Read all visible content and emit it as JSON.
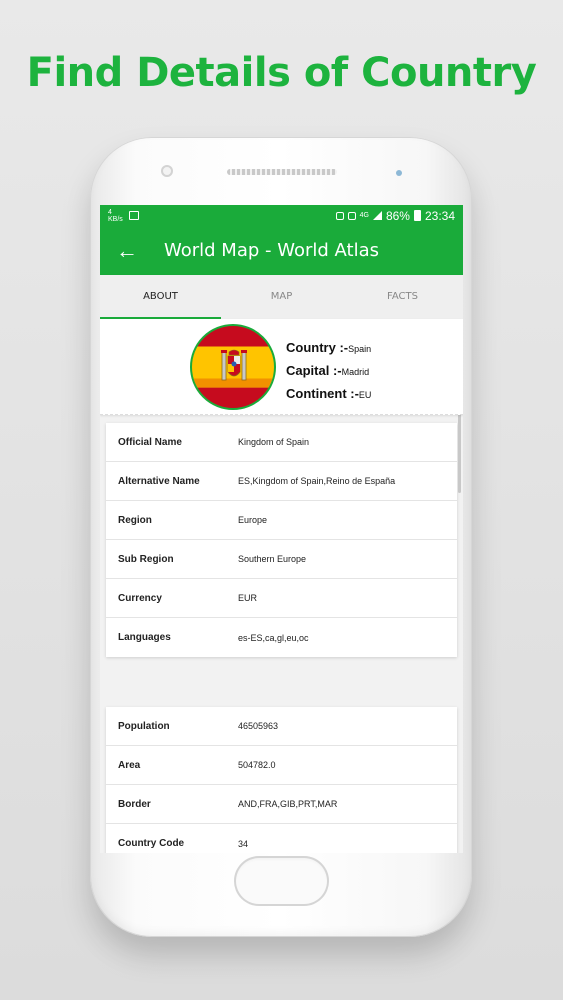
{
  "promo": {
    "title": "Find Details of Country"
  },
  "status_bar": {
    "left_speed": "4\nKB/s",
    "battery_percent": "86%",
    "time": "23:34",
    "network": "4G"
  },
  "app_bar": {
    "title": "World Map - World Atlas",
    "back_icon": "arrow-left-icon"
  },
  "tabs": [
    {
      "label": "ABOUT",
      "active": true
    },
    {
      "label": "MAP",
      "active": false
    },
    {
      "label": "FACTS",
      "active": false
    }
  ],
  "country": {
    "country_label": "Country :-",
    "country_value": "Spain",
    "capital_label": "Capital :-",
    "capital_value": "Madrid",
    "continent_label": "Continent :-",
    "continent_value": "EU"
  },
  "details": [
    {
      "label": "Official Name",
      "value": "Kingdom of Spain"
    },
    {
      "label": "Alternative Name",
      "value": "ES,Kingdom of Spain,Reino de España"
    },
    {
      "label": "Region",
      "value": "Europe"
    },
    {
      "label": "Sub Region",
      "value": "Southern Europe"
    },
    {
      "label": "Currency",
      "value": "EUR"
    },
    {
      "label": "Languages",
      "value": "es-ES,ca,gl,eu,oc"
    }
  ],
  "stats": [
    {
      "label": "Population",
      "value": "46505963"
    },
    {
      "label": "Area",
      "value": "504782.0"
    },
    {
      "label": "Border",
      "value": "AND,FRA,GIB,PRT,MAR"
    },
    {
      "label": "Country Code",
      "value": "34"
    }
  ],
  "colors": {
    "accent": "#1aab3a",
    "promo_text": "#1db33e"
  }
}
